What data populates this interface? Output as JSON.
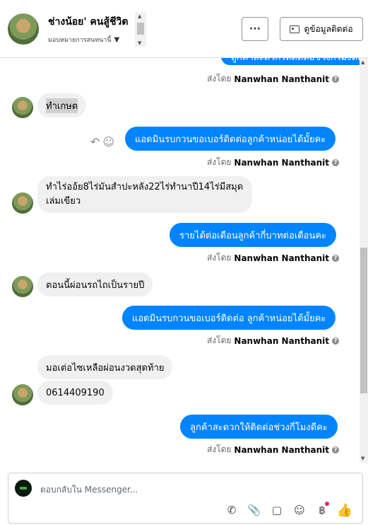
{
  "header": {
    "title": "ช่างน้อย' คนสู้ชีวิต",
    "assign": "มอบหมายการสนทนานี้",
    "more_label": "···",
    "contact_label": "ดูข้อมูลติดต่อ"
  },
  "thread": {
    "top_partial": "ลูกค้าสะดวกให้ติดต่อช่วงกี่โมงดีคะ",
    "sent_by_prefix": "ส่งโดย",
    "sender_name": "Nanwhan Nanthanit",
    "messages": [
      {
        "dir": "in",
        "text": "ทำเกษต"
      },
      {
        "dir": "out",
        "text": "แอดมินรบกวนขอเบอร์ติดต่อลูกค้าหน่อยได้มั้ยคะ"
      },
      {
        "dir": "in",
        "text": "ทำไร่ออ้ย8ไร่มันสำปะหลัง22ไร่ทำนาปี14ไร่มีสมุดเล่มเขียว"
      },
      {
        "dir": "out",
        "text": "รายได้ต่อเดือนลูกค้ากี่บาทต่อเดือนคะ"
      },
      {
        "dir": "in",
        "text": "ตอนนี้ผ่อนรถไถเป็นรายปี"
      },
      {
        "dir": "out",
        "text": "แอดมินรบกวนขอเบอร์ติดต่อ ลูกค้าหน่อยได้มั้ยคะ"
      },
      {
        "dir": "in",
        "text": "มอเต่อไซเหลือผ่อนงวดสุดท้าย"
      },
      {
        "dir": "in",
        "text": "0614409190"
      },
      {
        "dir": "out",
        "text": "ลูกค้าสะดวกให้ติดต่อช่วงกี่โมงดีคะ"
      }
    ]
  },
  "composer": {
    "placeholder": "ตอบกลับใน Messenger..."
  },
  "icons": {
    "reply": "reply-icon",
    "emoji": "smiley-icon",
    "contact_card": "contact-card-icon"
  },
  "colors": {
    "outgoing": "#0084ff",
    "incoming": "#f0f0f0",
    "muted": "#65676b"
  }
}
